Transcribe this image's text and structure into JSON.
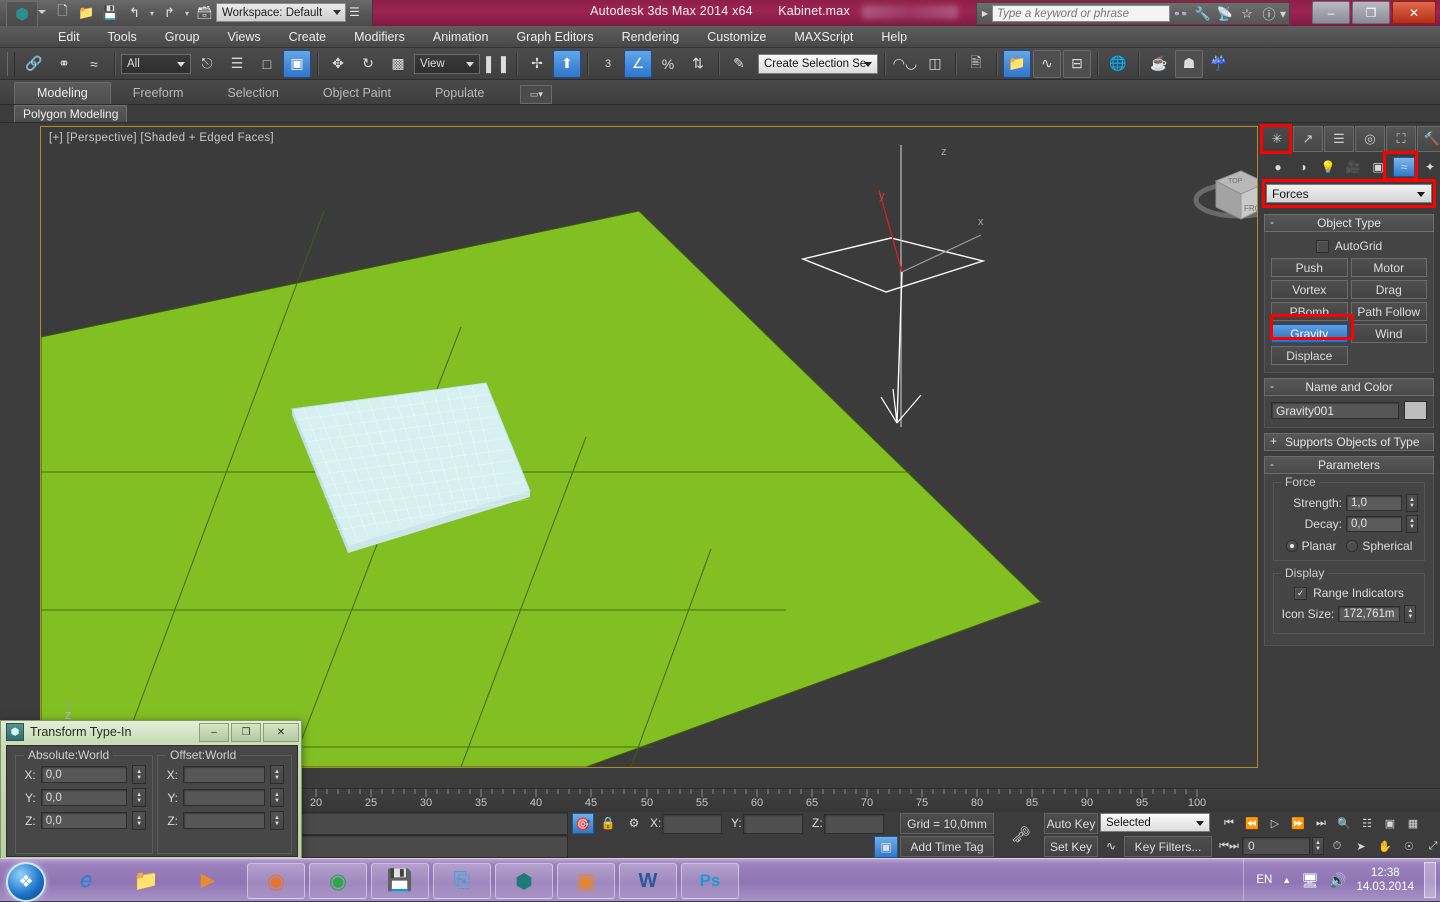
{
  "titlebar": {
    "app_title": "Autodesk 3ds Max  2014 x64",
    "file_name": "Kabinet.max",
    "workspace": "Workspace: Default",
    "search_placeholder": "Type a keyword or phrase",
    "quick_access": [
      "new-icon",
      "open-icon",
      "save-icon",
      "undo-icon",
      "redo-icon",
      "set-project-icon"
    ],
    "search_icons": [
      "binoculars-icon",
      "wrench-icon",
      "satellite-icon",
      "star-icon",
      "help-icon"
    ],
    "window_buttons": {
      "minimize": "–",
      "restore": "❐",
      "close": "✕"
    }
  },
  "menu": {
    "items": [
      "Edit",
      "Tools",
      "Group",
      "Views",
      "Create",
      "Modifiers",
      "Animation",
      "Graph Editors",
      "Rendering",
      "Customize",
      "MAXScript",
      "Help"
    ]
  },
  "toolbar": {
    "selection_filter": "All",
    "reference_coord": "View",
    "named_selection_sets": "Create Selection Se",
    "angle_snap_value": "3",
    "icons": [
      "select-link-icon",
      "unlink-icon",
      "bind-to-space-warp-icon",
      "select-object-icon",
      "select-by-name-icon",
      "rectangular-region-icon",
      "window-crossing-icon",
      "select-move-icon",
      "select-rotate-icon",
      "select-scale-icon",
      "mirror-icon",
      "align-icon",
      "layer-manager-icon",
      "scene-explorer-icon",
      "curve-editor-icon",
      "schematic-view-icon",
      "material-editor-icon",
      "render-setup-icon",
      "rendered-frame-window-icon",
      "render-production-icon"
    ]
  },
  "ribbon": {
    "tabs": [
      "Modeling",
      "Freeform",
      "Selection",
      "Object Paint",
      "Populate"
    ],
    "active_tab": "Modeling",
    "panel_title": "Polygon Modeling"
  },
  "viewport": {
    "label": "[+] [Perspective] [Shaded + Edged Faces]",
    "viewcube_faces": {
      "top": "TOP",
      "front": "FRONT"
    },
    "gizmo_axes": {
      "x": "x",
      "y": "y",
      "z": "z"
    },
    "world_axis": "Z",
    "ground_color": "#82bf23",
    "cloth_color": "#cfeff2",
    "background_color": "#3b3b3b"
  },
  "command_panel": {
    "tabs": [
      "create-tab-icon",
      "modify-tab-icon",
      "hierarchy-tab-icon",
      "motion-tab-icon",
      "display-tab-icon",
      "utilities-tab-icon"
    ],
    "active_tab_index": 0,
    "subcategories": [
      "geometry-icon",
      "shapes-icon",
      "lights-icon",
      "cameras-icon",
      "helpers-icon",
      "space-warps-icon",
      "systems-icon"
    ],
    "active_subcategory_index": 5,
    "category_dropdown": "Forces",
    "object_type": {
      "title": "Object Type",
      "collapse": "-",
      "autogrid_label": "AutoGrid",
      "autogrid_checked": false,
      "buttons": [
        "Push",
        "Motor",
        "Vortex",
        "Drag",
        "PBomb",
        "Path Follow",
        "Gravity",
        "Wind",
        "Displace"
      ],
      "selected_button": "Gravity"
    },
    "name_and_color": {
      "title": "Name and Color",
      "collapse": "-",
      "name": "Gravity001",
      "color": "#bdbdbd"
    },
    "supports_objects": {
      "title": "Supports Objects of Type",
      "collapse": "+"
    },
    "parameters": {
      "title": "Parameters",
      "collapse": "-",
      "force_group": "Force",
      "strength_label": "Strength:",
      "strength_value": "1,0",
      "decay_label": "Decay:",
      "decay_value": "0,0",
      "planar_label": "Planar",
      "spherical_label": "Spherical",
      "selected_shape": "Planar",
      "display_group": "Display",
      "range_indicators_label": "Range Indicators",
      "range_indicators_checked": true,
      "icon_size_label": "Icon Size:",
      "icon_size_value": "172,761m"
    },
    "highlight_color": "#ff0000"
  },
  "transform_dialog": {
    "title": "Transform Type-In",
    "window_buttons": {
      "minimize": "–",
      "maximize": "❐",
      "close": "✕"
    },
    "absolute_group": "Absolute:World",
    "offset_group": "Offset:World",
    "axis_labels": [
      "X:",
      "Y:",
      "Z:"
    ],
    "absolute_values": [
      "0,0",
      "0,0",
      "0,0"
    ],
    "offset_values": [
      "",
      "",
      ""
    ]
  },
  "timeline": {
    "tick_labels": [
      "20",
      "25",
      "30",
      "35",
      "40",
      "45",
      "50",
      "55",
      "60",
      "65",
      "70",
      "75",
      "80",
      "85",
      "90",
      "95",
      "100"
    ],
    "tick_positions": [
      316,
      371,
      426,
      481,
      536,
      591,
      647,
      702,
      757,
      812,
      867,
      922,
      977,
      1032,
      1087,
      1142,
      1197
    ]
  },
  "status_bar": {
    "prompt_text": "",
    "x_label": "X:",
    "y_label": "Y:",
    "z_label": "Z:",
    "x_value": "",
    "y_value": "",
    "z_value": "",
    "grid_text": "Grid = 10,0mm",
    "add_time_tag": "Add Time Tag",
    "auto_key": "Auto Key",
    "set_key": "Set Key",
    "key_mode_selection": "Selected",
    "key_filters": "Key Filters...",
    "frame_field": "0",
    "icons": [
      "selection-lock-icon",
      "absolute-relative-icon",
      "isolate-selection-icon",
      "key-icon",
      "zoom-icon",
      "zoom-all-icon",
      "zoom-extents-icon",
      "zoom-extents-all-icon",
      "field-of-view-icon",
      "pan-icon",
      "orbit-icon",
      "maximize-viewport-icon",
      "time-config-icon",
      "go-to-start-icon",
      "previous-frame-icon",
      "play-icon",
      "next-frame-icon",
      "go-to-end-icon",
      "key-mode-toggle-icon"
    ]
  },
  "taskbar": {
    "start_label": "start-orb-icon",
    "pinned": [
      "internet-explorer-icon",
      "explorer-icon",
      "media-player-icon"
    ],
    "apps": [
      "firefox-icon",
      "chrome-icon",
      "save-app-icon",
      "skype-icon",
      "3dsmax-icon",
      "outlook-icon",
      "word-icon",
      "photoshop-icon"
    ],
    "tray": {
      "language": "EN",
      "icons": [
        "show-hidden-icon",
        "network-icon",
        "volume-icon"
      ],
      "time": "12:38",
      "date": "14.03.2014"
    }
  }
}
